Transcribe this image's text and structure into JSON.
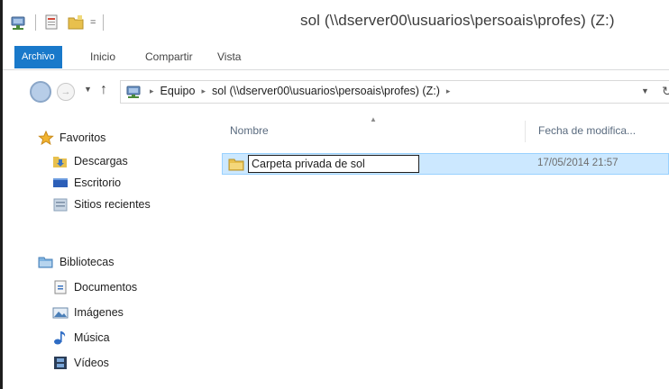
{
  "window": {
    "title": "sol (\\\\dserver00\\usuarios\\persoais\\profes) (Z:)",
    "qat_dropdown": "="
  },
  "ribbon": {
    "tabs": [
      {
        "label": "Archivo"
      },
      {
        "label": "Inicio"
      },
      {
        "label": "Compartir"
      },
      {
        "label": "Vista"
      }
    ]
  },
  "address": {
    "breadcrumbs": [
      "Equipo",
      "sol (\\\\dserver00\\usuarios\\persoais\\profes) (Z:)"
    ],
    "separator": "▸",
    "dropdown_icon": "chevron-down-icon",
    "refresh_icon": "refresh-icon"
  },
  "nav": {
    "favorites": {
      "label": "Favoritos",
      "items": [
        {
          "label": "Descargas",
          "icon": "downloads-icon"
        },
        {
          "label": "Escritorio",
          "icon": "desktop-icon"
        },
        {
          "label": "Sitios recientes",
          "icon": "recent-places-icon"
        }
      ]
    },
    "libraries": {
      "label": "Bibliotecas",
      "items": [
        {
          "label": "Documentos",
          "icon": "documents-icon"
        },
        {
          "label": "Imágenes",
          "icon": "pictures-icon"
        },
        {
          "label": "Música",
          "icon": "music-icon"
        },
        {
          "label": "Vídeos",
          "icon": "videos-icon"
        }
      ]
    }
  },
  "content": {
    "columns": {
      "name": "Nombre",
      "date": "Fecha de modifica..."
    },
    "rows": [
      {
        "name": "Carpeta privada de sol",
        "date": "17/05/2014 21:57",
        "selected": true,
        "editing": true
      }
    ]
  },
  "colors": {
    "accent": "#1979ca",
    "selection": "#cce8ff",
    "selection_border": "#99d1ff",
    "folder": "#e8c04d"
  }
}
